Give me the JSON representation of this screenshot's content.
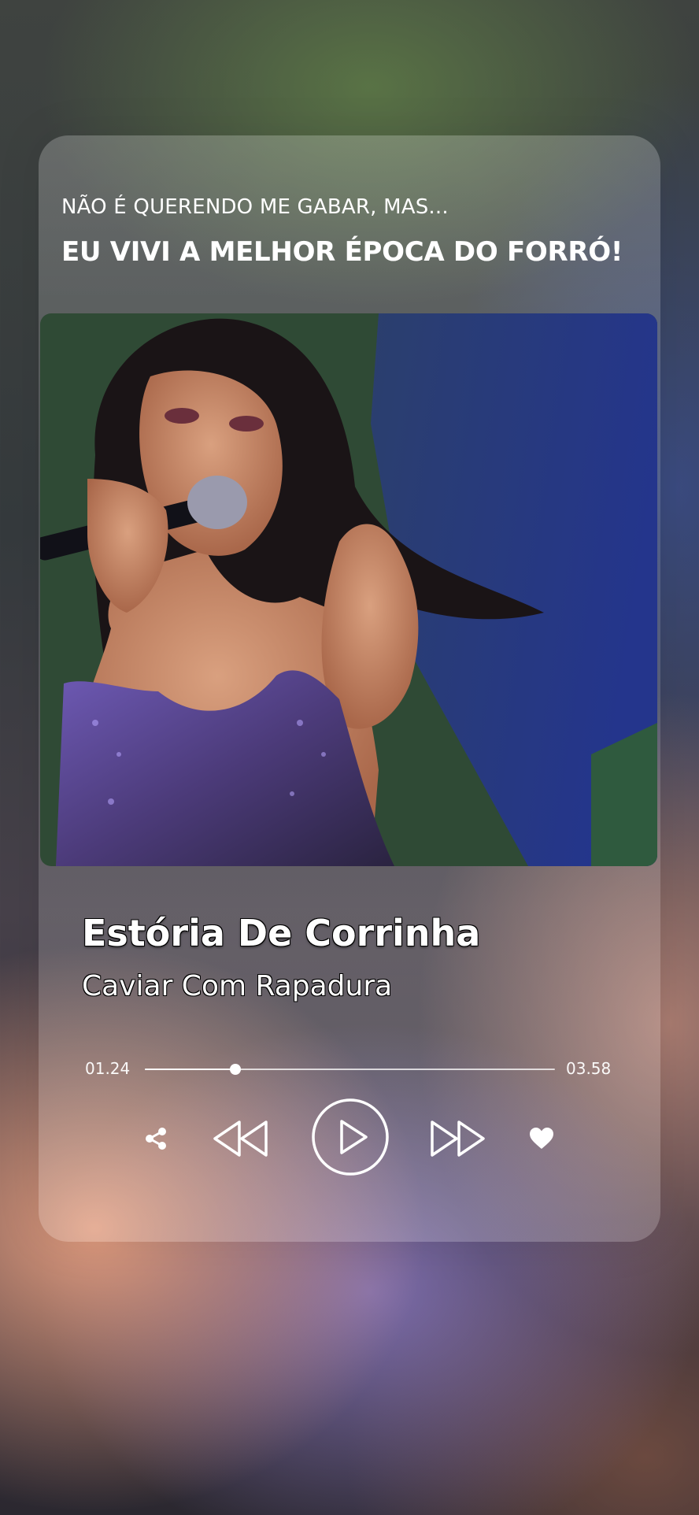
{
  "banner": {
    "subtitle": "NÃO É QUERENDO ME GABAR, MAS...",
    "headline": "EU VIVI A MELHOR ÉPOCA DO FORRÓ!"
  },
  "player": {
    "song_title": "Estória De Corrinha",
    "artist": "Caviar Com Rapadura",
    "elapsed": "01.24",
    "total": "03.58",
    "progress": 0.22
  },
  "controls": [
    {
      "name": "share",
      "icon": "share-icon"
    },
    {
      "name": "rewind",
      "icon": "rewind-icon"
    },
    {
      "name": "play",
      "icon": "play-icon"
    },
    {
      "name": "forward",
      "icon": "fast-forward-icon"
    },
    {
      "name": "like",
      "icon": "heart-icon"
    }
  ],
  "colors": {
    "text": "#ffffff",
    "card_overlay": "rgba(255,255,255,0.16)"
  }
}
